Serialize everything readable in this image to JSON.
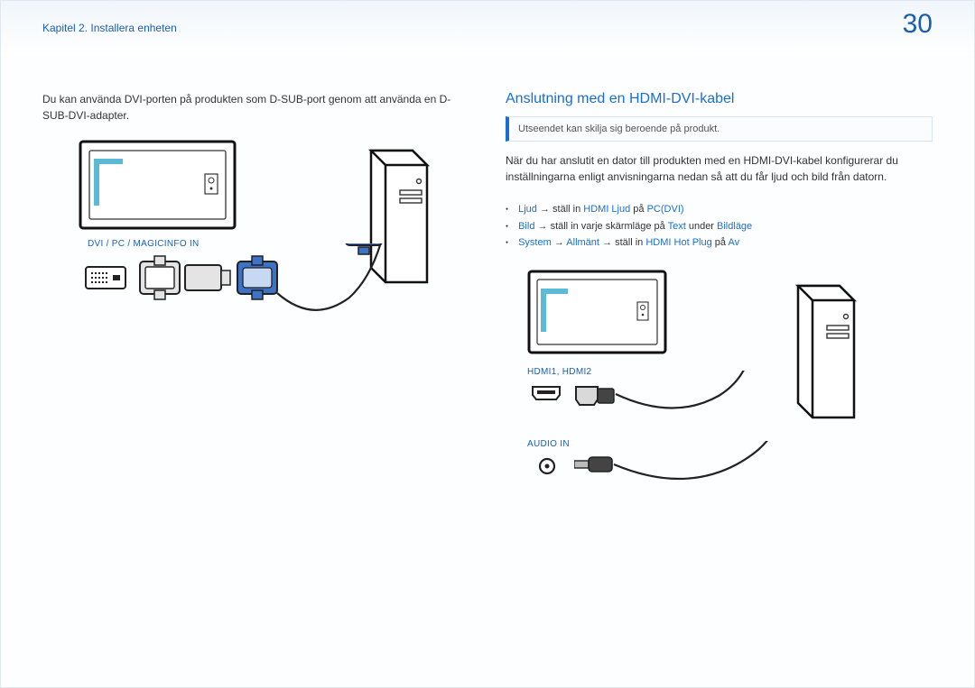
{
  "header": {
    "chapter": "Kapitel 2. Installera enheten",
    "page_number": "30"
  },
  "left": {
    "intro": "Du kan använda DVI-porten på produkten som D-SUB-port genom att använda en D-SUB-DVI-adapter.",
    "port_label": "DVI / PC / MAGICINFO IN"
  },
  "right": {
    "section_title": "Anslutning med en HDMI-DVI-kabel",
    "note": "Utseendet kan skilja sig beroende på produkt.",
    "body": "När du har anslutit en dator till produkten med en HDMI-DVI-kabel konfigurerar du inställningarna enligt anvisningarna nedan så att du får ljud och bild från datorn.",
    "bullets": [
      {
        "t1": "Ljud",
        "arrow": " → ",
        "mid": "ställ in ",
        "t2": "HDMI Ljud",
        "mid2": " på ",
        "t3": "PC(DVI)"
      },
      {
        "t1": "Bild",
        "arrow": " → ",
        "mid": "ställ in varje skärmläge på ",
        "t2": "Text",
        "mid2": " under ",
        "t3": "Bildläge"
      },
      {
        "t1": "System",
        "arrow": " → ",
        "t1b": "Allmänt",
        "arrow2": " → ",
        "mid": "ställ in ",
        "t2": "HDMI Hot Plug",
        "mid2": " på ",
        "t3": "Av"
      }
    ],
    "port_label_hdmi": "HDMI1, HDMI2",
    "port_label_audio": "AUDIO IN"
  }
}
